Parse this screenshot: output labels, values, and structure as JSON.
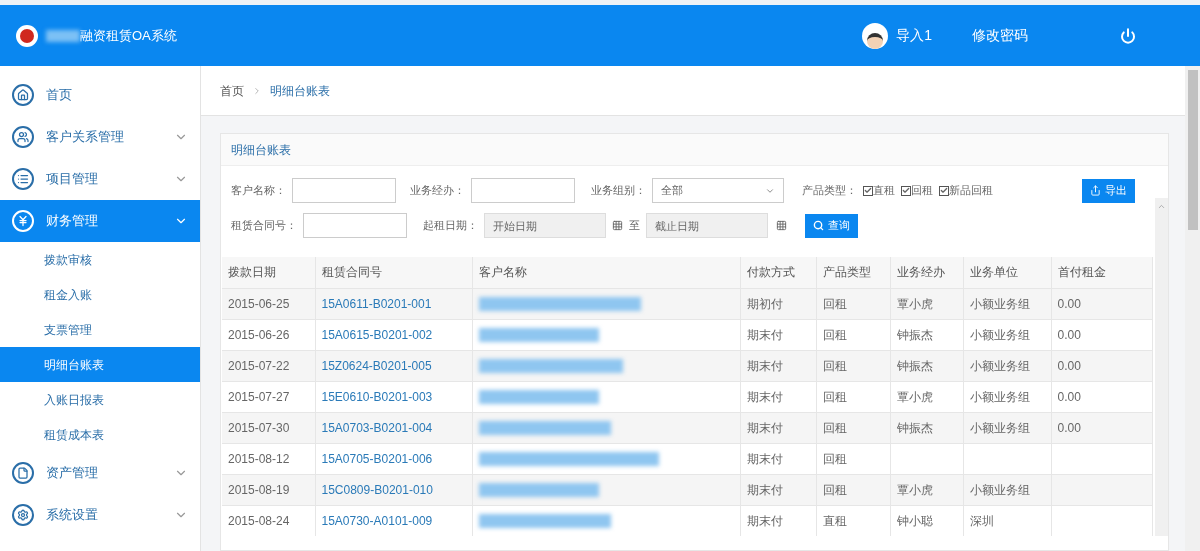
{
  "header": {
    "title": "融资租赁OA系统",
    "user": "导入1",
    "change_password": "修改密码"
  },
  "sidebar": {
    "items": [
      {
        "label": "首页",
        "selected": false
      },
      {
        "label": "客户关系管理",
        "selected": false,
        "expanded": false
      },
      {
        "label": "项目管理",
        "selected": false,
        "expanded": false
      },
      {
        "label": "财务管理",
        "selected": true,
        "expanded": true,
        "children": [
          {
            "label": "拨款审核",
            "selected": false
          },
          {
            "label": "租金入账",
            "selected": false
          },
          {
            "label": "支票管理",
            "selected": false
          },
          {
            "label": "明细台账表",
            "selected": true
          },
          {
            "label": "入账日报表",
            "selected": false
          },
          {
            "label": "租赁成本表",
            "selected": false
          }
        ]
      },
      {
        "label": "资产管理",
        "selected": false,
        "expanded": false
      },
      {
        "label": "系统设置",
        "selected": false,
        "expanded": false
      }
    ]
  },
  "breadcrumb": [
    "首页",
    "明细台账表"
  ],
  "panel": {
    "title": "明细台账表",
    "filters": {
      "customer_label": "客户名称：",
      "agent_label": "业务经办：",
      "group_label": "业务组别：",
      "group_value": "全部",
      "product_label": "产品类型：",
      "products": [
        {
          "label": "直租",
          "checked": true
        },
        {
          "label": "回租",
          "checked": true
        },
        {
          "label": "新品回租",
          "checked": true
        }
      ],
      "contract_label": "租赁合同号：",
      "date_label": "起租日期：",
      "start_placeholder": "开始日期",
      "to": "至",
      "end_placeholder": "截止日期"
    },
    "export_button": "导出",
    "search_button": "查询"
  },
  "table": {
    "columns": [
      "拨款日期",
      "租赁合同号",
      "客户名称",
      "付款方式",
      "产品类型",
      "业务经办",
      "业务单位",
      "首付租金"
    ],
    "rows": [
      [
        "2015-06-25",
        "15A0611-B0201-001",
        "",
        "期初付",
        "回租",
        "覃小虎",
        "小额业务组",
        "0.00"
      ],
      [
        "2015-06-26",
        "15A0615-B0201-002",
        "",
        "期末付",
        "回租",
        "钟振杰",
        "小额业务组",
        "0.00"
      ],
      [
        "2015-07-22",
        "15Z0624-B0201-005",
        "",
        "期末付",
        "回租",
        "钟振杰",
        "小额业务组",
        "0.00"
      ],
      [
        "2015-07-27",
        "15E0610-B0201-003",
        "",
        "期末付",
        "回租",
        "覃小虎",
        "小额业务组",
        "0.00"
      ],
      [
        "2015-07-30",
        "15A0703-B0201-004",
        "",
        "期末付",
        "回租",
        "钟振杰",
        "小额业务组",
        "0.00"
      ],
      [
        "2015-08-12",
        "15A0705-B0201-006",
        "",
        "期末付",
        "回租",
        "",
        "",
        ""
      ],
      [
        "2015-08-19",
        "15C0809-B0201-010",
        "",
        "期末付",
        "回租",
        "覃小虎",
        "小额业务组",
        ""
      ],
      [
        "2015-08-24",
        "15A0730-A0101-009",
        "",
        "期末付",
        "直租",
        "钟小聪",
        "深圳",
        ""
      ]
    ]
  }
}
